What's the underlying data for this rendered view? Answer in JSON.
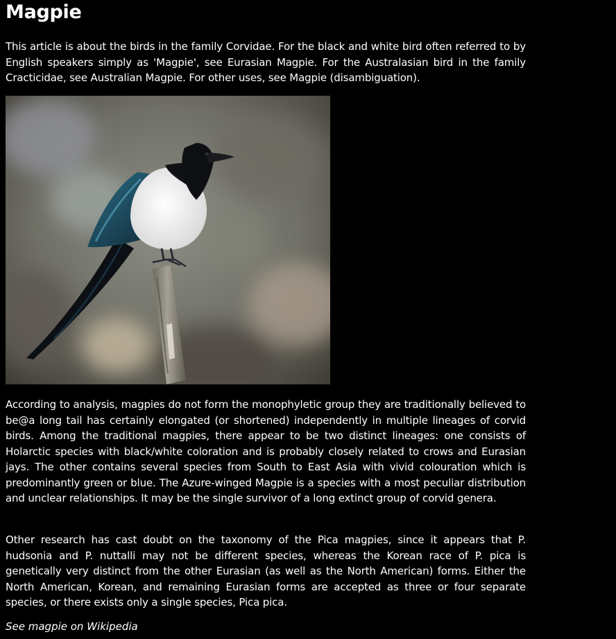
{
  "article": {
    "title": "Magpie",
    "hatnote": "This article is about the birds in the family Corvidae. For the black and white bird often referred to by English speakers simply as 'Magpie', see Eurasian Magpie. For the Australasian bird in the family Cracticidae, see Australian Magpie. For other uses, see Magpie (disambiguation).",
    "paragraphs": [
      "According to analysis, magpies do not form the monophyletic group they are traditionally believed to be@a long tail has certainly elongated (or shortened) independently in multiple lineages of corvid birds. Among the traditional magpies, there appear to be two distinct lineages: one consists of Holarctic species with black/white coloration and is probably closely related to crows and Eurasian jays. The other contains several species from South to East Asia with vivid colouration which is predominantly green or blue. The Azure-winged Magpie is a species with a most peculiar distribution and unclear relationships. It may be the single survivor of a long extinct group of corvid genera.",
      "Other research has cast doubt on the taxonomy of the Pica magpies, since it appears that P. hudsonia and P. nuttalli may not be different species, whereas the Korean race of P. pica is genetically very distinct from the other Eurasian (as well as the North American) forms. Either the North American, Korean, and remaining Eurasian forms are accepted as three or four separate species, or there exists only a single species, Pica pica."
    ],
    "source_link": "See magpie on Wikipedia"
  },
  "colors": {
    "page_background": "#000000",
    "text": "#ffffff"
  }
}
